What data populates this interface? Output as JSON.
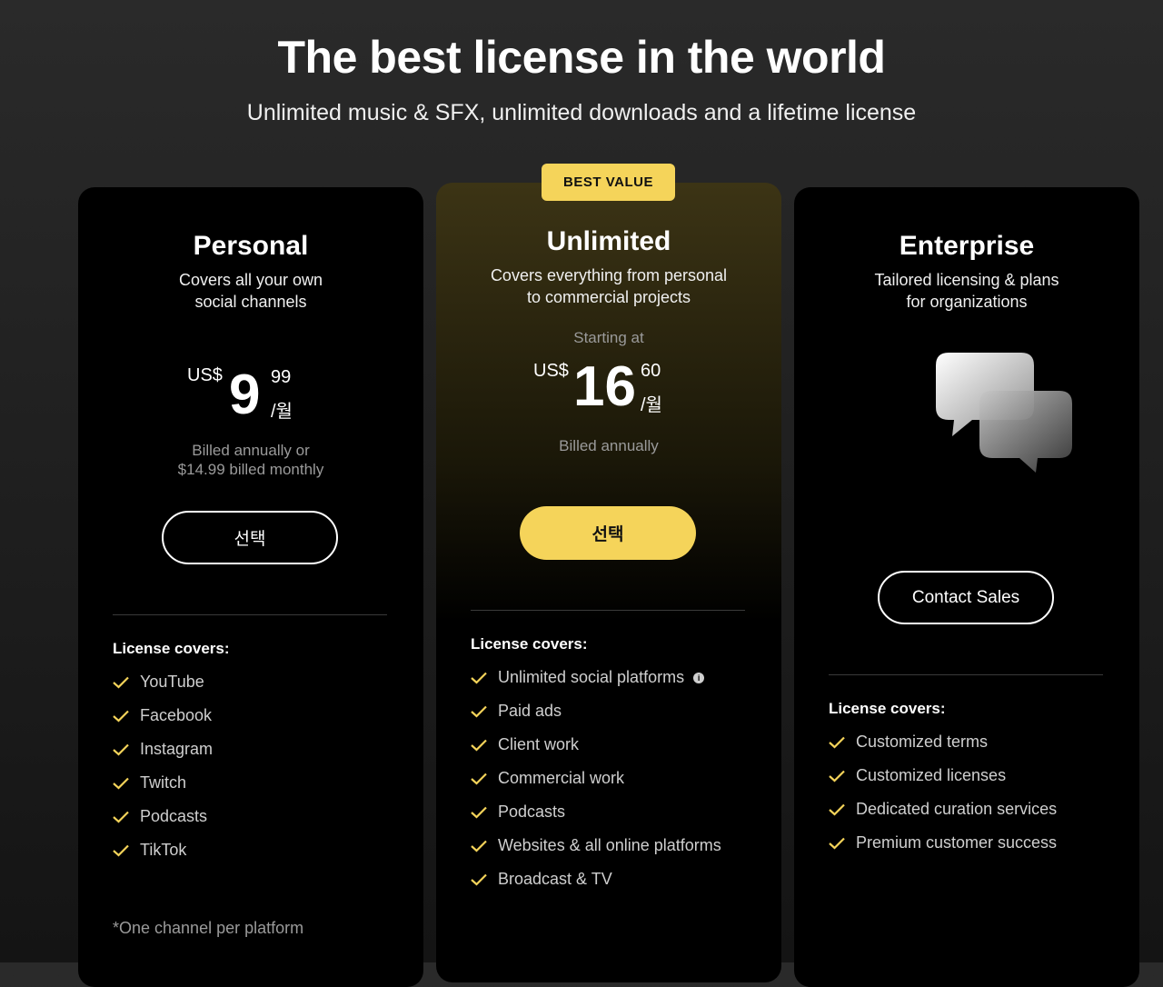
{
  "header": {
    "title": "The best license in the world",
    "subtitle": "Unlimited music & SFX, unlimited downloads and a lifetime license"
  },
  "plans": {
    "personal": {
      "name": "Personal",
      "desc_line1": "Covers all your own",
      "desc_line2": "social channels",
      "currency": "US$",
      "price_int": "9",
      "price_cents": "99",
      "per": "/월",
      "billed_line1": "Billed annually or",
      "billed_line2": "$14.99 billed monthly",
      "button": "선택",
      "covers_title": "License covers:",
      "features": [
        "YouTube",
        "Facebook",
        "Instagram",
        "Twitch",
        "Podcasts",
        "TikTok"
      ],
      "footnote": "*One channel per platform"
    },
    "unlimited": {
      "badge": "BEST VALUE",
      "name": "Unlimited",
      "desc_line1": "Covers everything from personal",
      "desc_line2": "to commercial projects",
      "starting": "Starting at",
      "currency": "US$",
      "price_int": "16",
      "price_cents": "60",
      "per": "/월",
      "billed": "Billed annually",
      "button": "선택",
      "covers_title": "License covers:",
      "features": [
        "Unlimited social platforms",
        "Paid ads",
        "Client work",
        "Commercial work",
        "Podcasts",
        "Websites & all online platforms",
        "Broadcast & TV"
      ]
    },
    "enterprise": {
      "name": "Enterprise",
      "desc_line1": "Tailored licensing & plans",
      "desc_line2": "for organizations",
      "button": "Contact Sales",
      "covers_title": "License covers:",
      "features": [
        "Customized terms",
        "Customized licenses",
        "Dedicated curation services",
        "Premium customer success"
      ]
    }
  },
  "colors": {
    "accent": "#f5d45a",
    "card_bg": "#000000",
    "page_bg": "#1e1e1e"
  },
  "icons": {
    "check": "check-icon",
    "info": "info-icon",
    "chat": "chat-bubbles-icon"
  }
}
